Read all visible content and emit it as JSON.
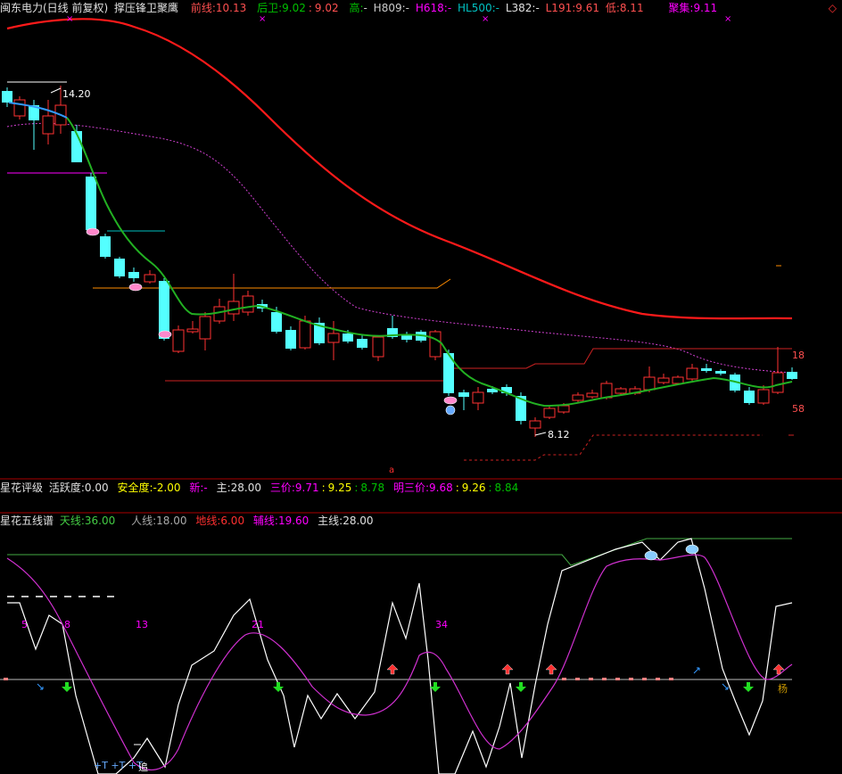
{
  "header": {
    "stock_title": "闽东电力(日线 前复权)",
    "indicator_name": "撑压锋卫聚鹰",
    "front_line": {
      "label": "前线:",
      "value": "10.13"
    },
    "back_guard": {
      "label": "后卫:",
      "v1": "9.02",
      "sep": ":",
      "v2": "9.02"
    },
    "high": {
      "label": "高:",
      "value": "-"
    },
    "h809": {
      "label": "H809:",
      "value": "-"
    },
    "h618": {
      "label": "H618:",
      "value": "-"
    },
    "hl500": {
      "label": "HL500:",
      "value": "-"
    },
    "l382": {
      "label": "L382:",
      "value": "-"
    },
    "l191": {
      "label": "L191:",
      "value": "9.61"
    },
    "low": {
      "label": "低:",
      "value": "8.11"
    },
    "gather": {
      "label": "聚集:",
      "value": "9.11"
    },
    "corner_icon": "diamond-outline-icon"
  },
  "price_labels": {
    "high_mark": "14.20",
    "low_mark": "8.12",
    "right_top": "18",
    "right_bottom": "58"
  },
  "rating_bar": {
    "title": "星花评级",
    "activity": {
      "label": "活跃度:",
      "value": "0.00"
    },
    "safety": {
      "label": "安全度:",
      "value": "-2.00"
    },
    "new": {
      "label": "新:",
      "value": "-"
    },
    "main": {
      "label": "主:",
      "value": "28.00"
    },
    "three_price": {
      "label": "三价:",
      "v1": "9.71",
      "sep1": ":",
      "v2": "9.25",
      "sep2": ":",
      "v3": "8.78"
    },
    "bright_three": {
      "label": "明三价:",
      "v1": "9.68",
      "sep1": ":",
      "v2": "9.26",
      "sep2": ":",
      "v3": "8.84"
    }
  },
  "five_line_bar": {
    "title": "星花五线谱",
    "sky": {
      "label": "天线:",
      "value": "36.00"
    },
    "human": {
      "label": "人线:",
      "value": "18.00"
    },
    "ground": {
      "label": "地线:",
      "value": "6.00"
    },
    "aux": {
      "label": "辅线:",
      "value": "19.60"
    },
    "main": {
      "label": "主线:",
      "value": "28.00"
    }
  },
  "fib_labels": [
    "5",
    "8",
    "13",
    "21",
    "34"
  ],
  "bottom_labels": {
    "t_marks": "+T +T +T",
    "zhuang": "追",
    "yang": "杨",
    "alert": "a"
  },
  "colors": {
    "bg": "#000000",
    "up": "#ff3232",
    "down": "#54ffff",
    "ma_green": "#00c000",
    "ma_red": "#ff0000",
    "magenta": "#ff00ff",
    "white": "#ffffff",
    "yellow": "#ffff00",
    "orange": "#ff8c00",
    "grid": "#aa0000"
  }
}
